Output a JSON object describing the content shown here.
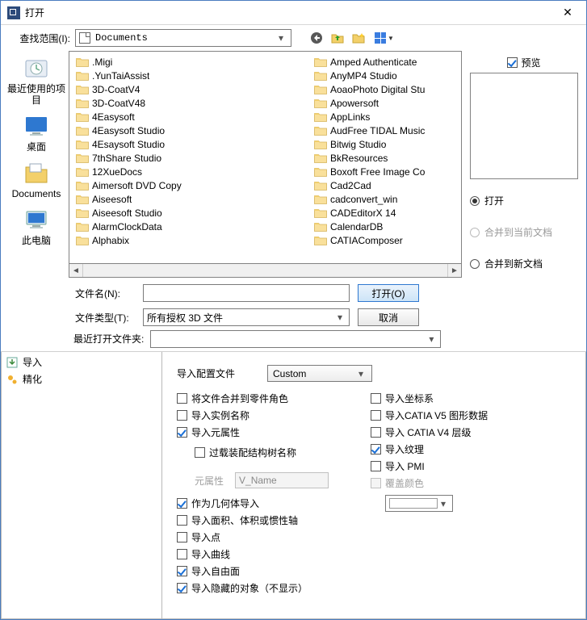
{
  "titlebar": {
    "title": "打开"
  },
  "lookin": {
    "label": "查找范围(I):",
    "value": "Documents"
  },
  "places": {
    "recent": "最近使用的项目",
    "desktop": "桌面",
    "documents": "Documents",
    "thispc": "此电脑"
  },
  "file_columns": [
    [
      ".Migi",
      ".YunTaiAssist",
      "3D-CoatV4",
      "3D-CoatV48",
      "4Easysoft",
      "4Easysoft Studio",
      "4Esaysoft Studio",
      "7thShare Studio",
      "12XueDocs",
      "Aimersoft DVD Copy",
      "Aiseesoft",
      "Aiseesoft Studio",
      "AlarmClockData",
      "Alphabix"
    ],
    [
      "Amped Authenticate",
      "AnyMP4 Studio",
      "AoaoPhoto Digital Stu",
      "Apowersoft",
      "AppLinks",
      "AudFree TIDAL Music",
      "Bitwig Studio",
      "BkResources",
      "Boxoft Free Image Co",
      "Cad2Cad",
      "cadconvert_win",
      "CADEditorX 14",
      "CalendarDB",
      "CATIAComposer"
    ]
  ],
  "filename": {
    "name_label": "文件名(N):",
    "name_value": "",
    "type_label": "文件类型(T):",
    "type_value": "所有授权 3D 文件",
    "open_btn": "打开(O)",
    "cancel_btn": "取消"
  },
  "right_panel": {
    "preview_label": "预览",
    "radio_open": "打开",
    "radio_merge_current": "合并到当前文档",
    "radio_merge_new": "合并到新文档"
  },
  "recent_folder": {
    "label": "最近打开文件夹:",
    "value": ""
  },
  "settings_sidebar": {
    "import": "导入",
    "refine": "精化"
  },
  "settings": {
    "config_label": "导入配置文件",
    "config_value": "Custom",
    "left": {
      "merge_parts": "将文件合并到零件角色",
      "import_instance_name": "导入实例名称",
      "import_metadata": "导入元属性",
      "overload_tree_name": "过载装配结构树名称",
      "metadata_label": "元属性",
      "metadata_value": "V_Name",
      "as_geometry": "作为几何体导入",
      "import_area_volume": "导入面积、体积或惯性轴",
      "import_points": "导入点",
      "import_curves": "导入曲线",
      "import_freeform": "导入自由面",
      "import_hidden": "导入隐藏的对象（不显示）"
    },
    "right": {
      "coord_system": "导入坐标系",
      "catia_v5_graphic": "导入CATIA V5 图形数据",
      "catia_v4_layer": "导入 CATIA V4 层级",
      "import_texture": "导入纹理",
      "import_pmi": "导入 PMI",
      "override_color": "覆盖颜色"
    }
  }
}
